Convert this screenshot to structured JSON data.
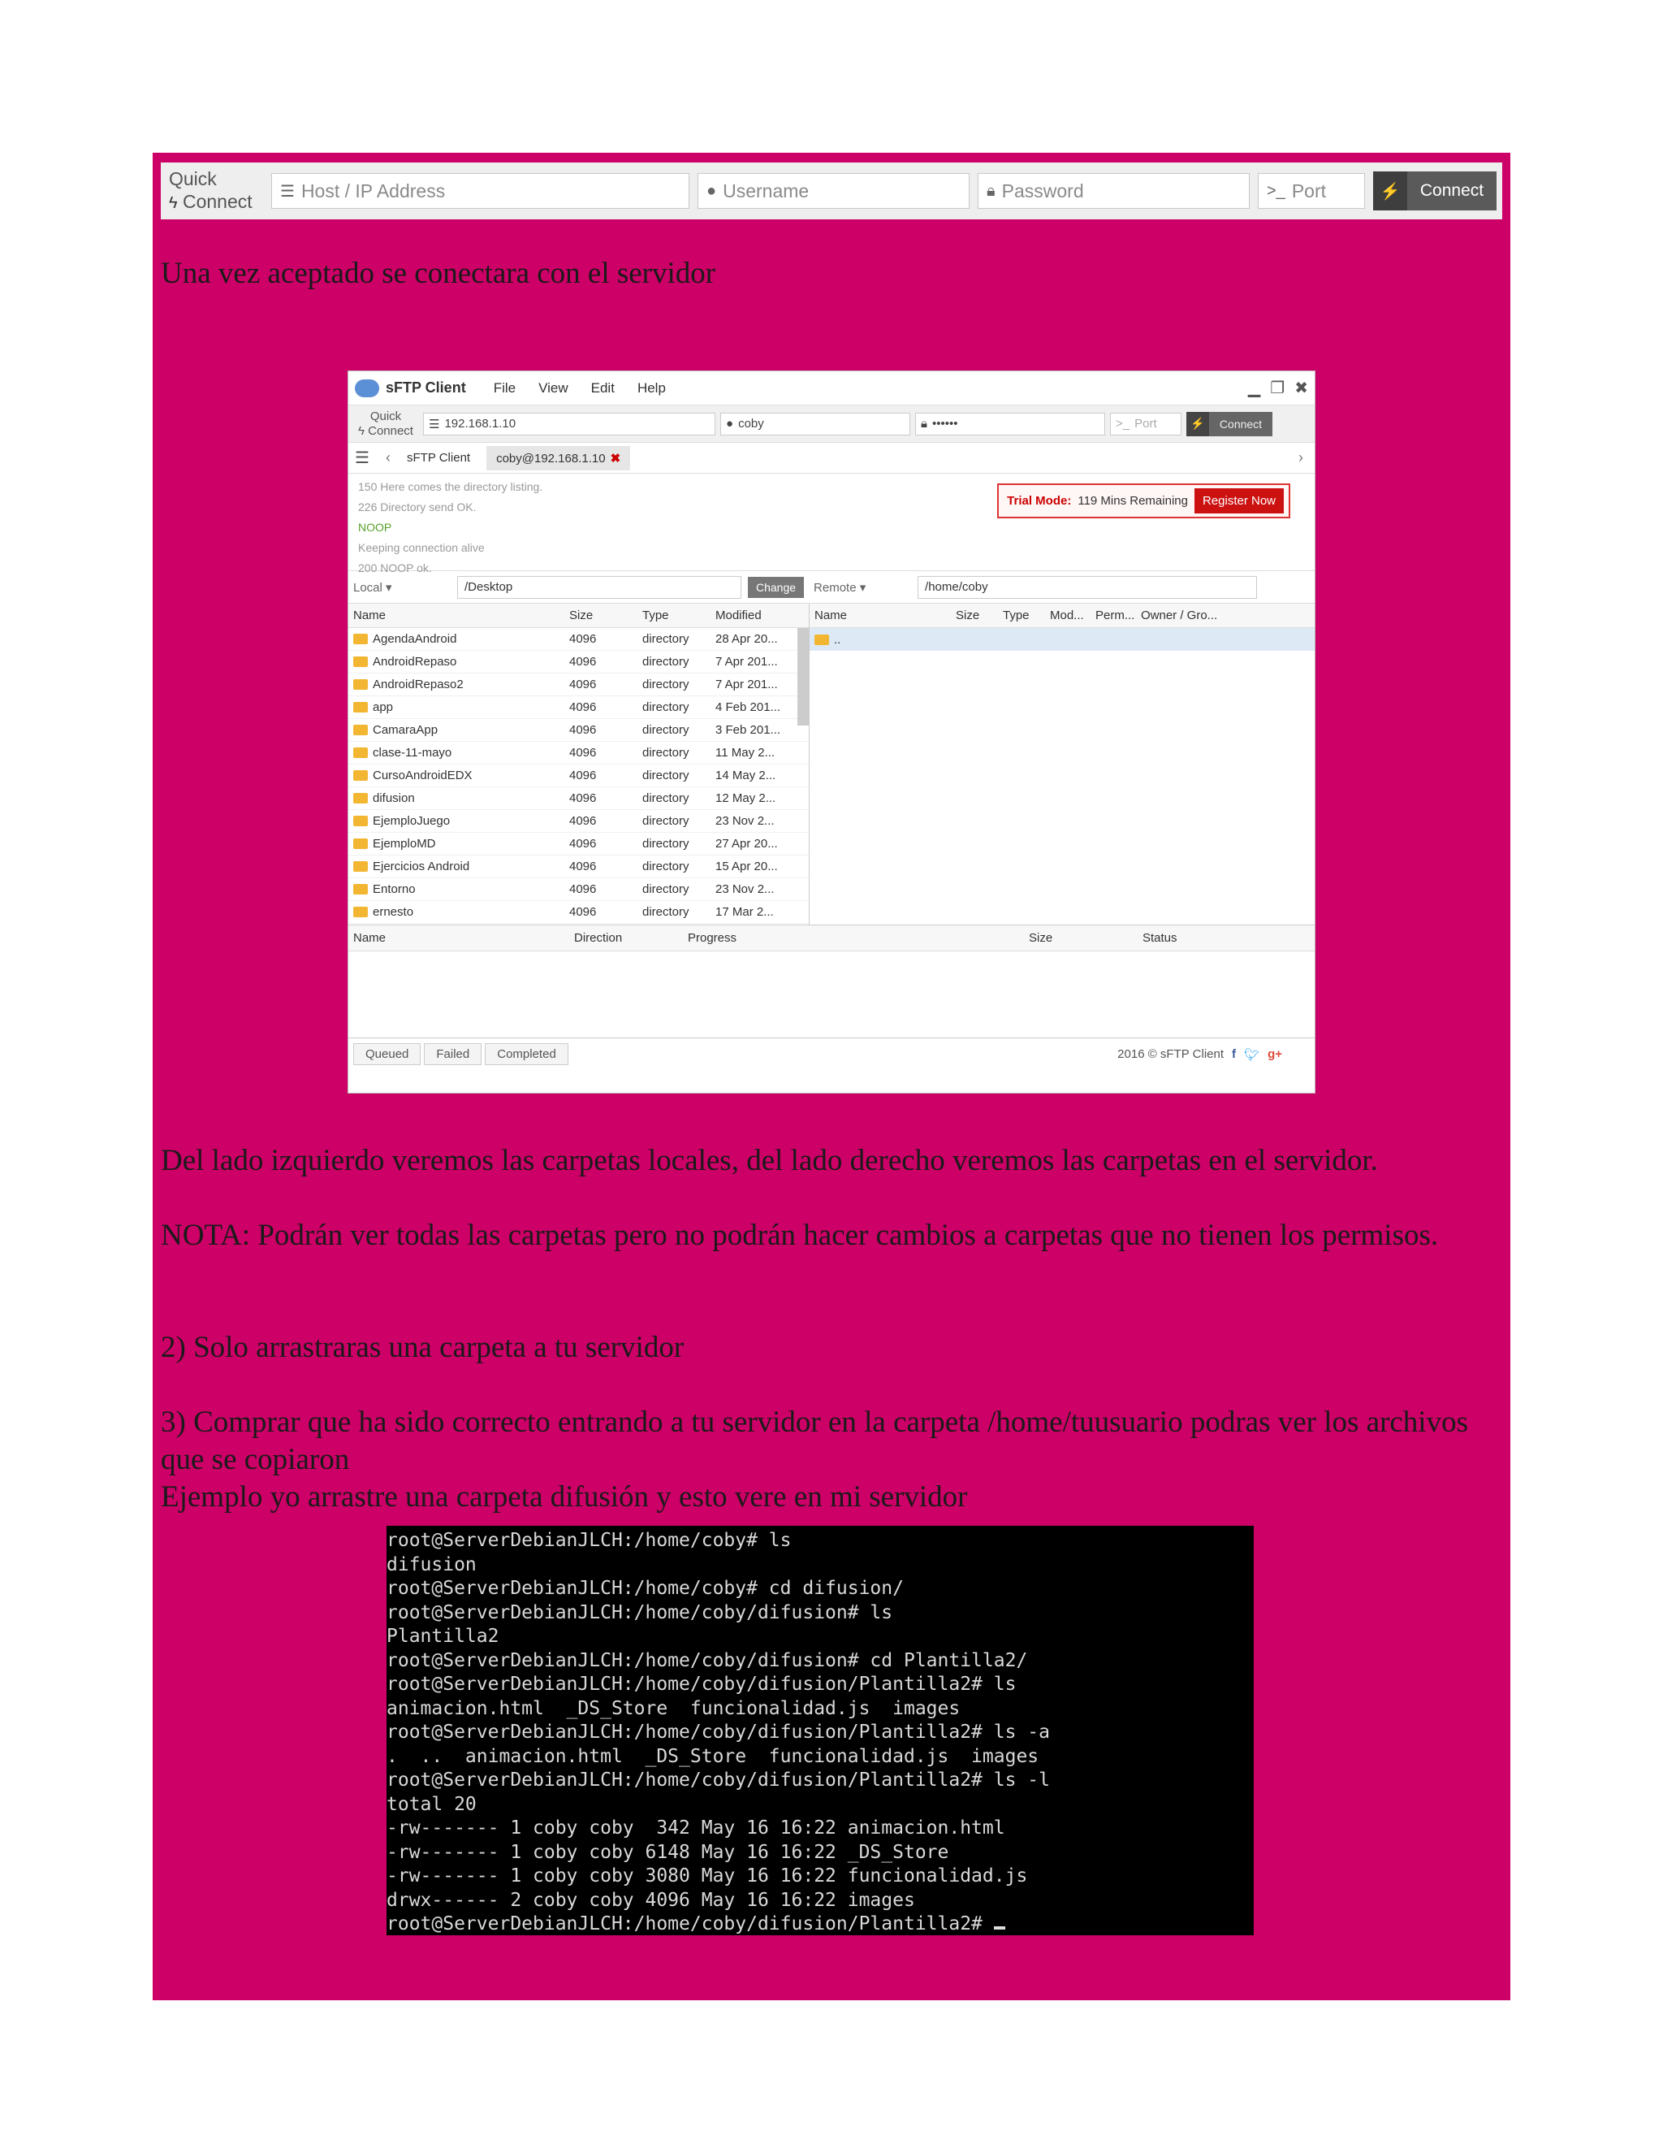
{
  "quick_connect": {
    "label_line1": "Quick",
    "label_line2": "Connect",
    "host_placeholder": "Host / IP Address",
    "username_placeholder": "Username",
    "password_placeholder": "Password",
    "port_placeholder": "Port",
    "connect_label": "Connect"
  },
  "paragraph1": "Una vez aceptado se conectara con el servidor",
  "sftp": {
    "title": "sFTP Client",
    "menu": [
      "File",
      "View",
      "Edit",
      "Help"
    ],
    "qc": {
      "label_line1": "Quick",
      "label_line2": "Connect",
      "host": "192.168.1.10",
      "user": "coby",
      "password": "••••••",
      "port_placeholder": "Port",
      "connect": "Connect"
    },
    "tabs": [
      "sFTP Client",
      "coby@192.168.1.10"
    ],
    "log": [
      "150 Here comes the directory listing.",
      "226 Directory send OK.",
      "NOOP",
      "Keeping connection alive",
      "200 NOOP ok."
    ],
    "trial": {
      "label": "Trial Mode:",
      "text": "119 Mins Remaining",
      "register": "Register Now"
    },
    "local_label": "Local",
    "local_path": "/Desktop",
    "change": "Change",
    "remote_label": "Remote",
    "remote_path": "/home/coby",
    "local_cols": [
      "Name",
      "Size",
      "Type",
      "Modified"
    ],
    "local_rows": [
      [
        "AgendaAndroid",
        "4096",
        "directory",
        "28 Apr 20..."
      ],
      [
        "AndroidRepaso",
        "4096",
        "directory",
        "7 Apr 201..."
      ],
      [
        "AndroidRepaso2",
        "4096",
        "directory",
        "7 Apr 201..."
      ],
      [
        "app",
        "4096",
        "directory",
        "4 Feb 201..."
      ],
      [
        "CamaraApp",
        "4096",
        "directory",
        "3 Feb 201..."
      ],
      [
        "clase-11-mayo",
        "4096",
        "directory",
        "11 May 2..."
      ],
      [
        "CursoAndroidEDX",
        "4096",
        "directory",
        "14 May 2..."
      ],
      [
        "difusion",
        "4096",
        "directory",
        "12 May 2..."
      ],
      [
        "EjemploJuego",
        "4096",
        "directory",
        "23 Nov 2..."
      ],
      [
        "EjemploMD",
        "4096",
        "directory",
        "27 Apr 20..."
      ],
      [
        "Ejercicios Android",
        "4096",
        "directory",
        "15 Apr 20..."
      ],
      [
        "Entorno",
        "4096",
        "directory",
        "23 Nov 2..."
      ],
      [
        "ernesto",
        "4096",
        "directory",
        "17 Mar 2..."
      ]
    ],
    "remote_cols": [
      "Name",
      "Size",
      "Type",
      "Mod...",
      "Perm...",
      "Owner / Gro..."
    ],
    "remote_row": "..",
    "queue_cols": [
      "Name",
      "Direction",
      "Progress",
      "Size",
      "Status"
    ],
    "footer_tabs": [
      "Queued",
      "Failed",
      "Completed"
    ],
    "copyright": "2016 © sFTP Client"
  },
  "paragraph2": "Del lado izquierdo veremos las carpetas locales, del lado derecho veremos las carpetas en el servidor.",
  "paragraph3": "NOTA: Podrán ver todas las carpetas pero no podrán hacer cambios a carpetas que no tienen los permisos.",
  "paragraph4": "2) Solo arrastraras una carpeta a tu servidor",
  "paragraph5": "3) Comprar que ha sido correcto entrando a tu servidor en la carpeta /home/tuusuario podras ver los archivos que se copiaron",
  "paragraph6": "Ejemplo yo arrastre una carpeta difusión y esto vere en mi servidor",
  "terminal_lines": [
    "root@ServerDebianJLCH:/home/coby# ls",
    "difusion",
    "root@ServerDebianJLCH:/home/coby# cd difusion/",
    "root@ServerDebianJLCH:/home/coby/difusion# ls",
    "Plantilla2",
    "root@ServerDebianJLCH:/home/coby/difusion# cd Plantilla2/",
    "root@ServerDebianJLCH:/home/coby/difusion/Plantilla2# ls",
    "animacion.html  _DS_Store  funcionalidad.js  images",
    "root@ServerDebianJLCH:/home/coby/difusion/Plantilla2# ls -a",
    ".  ..  animacion.html  _DS_Store  funcionalidad.js  images",
    "root@ServerDebianJLCH:/home/coby/difusion/Plantilla2# ls -l",
    "total 20",
    "-rw------- 1 coby coby  342 May 16 16:22 animacion.html",
    "-rw------- 1 coby coby 6148 May 16 16:22 _DS_Store",
    "-rw------- 1 coby coby 3080 May 16 16:22 funcionalidad.js",
    "drwx------ 2 coby coby 4096 May 16 16:22 images",
    "root@ServerDebianJLCH:/home/coby/difusion/Plantilla2# "
  ],
  "icon_names": [
    "bolt-icon",
    "server-icon",
    "user-icon",
    "lock-icon",
    "terminal-icon",
    "plug-icon",
    "folder-icon",
    "close-icon",
    "facebook-icon",
    "twitter-icon",
    "googleplus-icon"
  ]
}
